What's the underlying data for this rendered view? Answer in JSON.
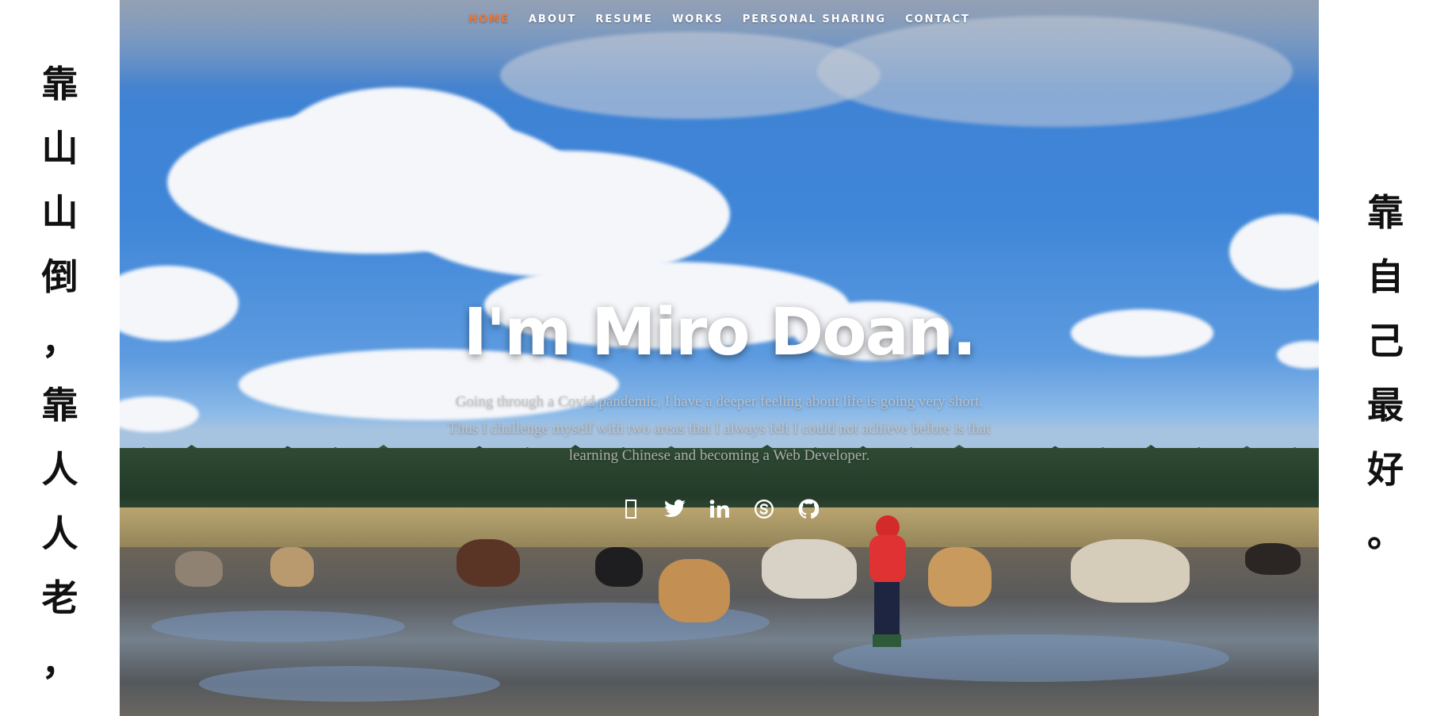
{
  "side_left": {
    "chars": [
      "靠",
      "山",
      "山",
      "倒",
      "，",
      "靠",
      "人",
      "人",
      "老",
      "，"
    ]
  },
  "side_right": {
    "chars": [
      "靠",
      "自",
      "己",
      "最",
      "好",
      "。"
    ]
  },
  "nav": {
    "items": [
      {
        "label": "HOME",
        "active": true
      },
      {
        "label": "ABOUT",
        "active": false
      },
      {
        "label": "RESUME",
        "active": false
      },
      {
        "label": "WORKS",
        "active": false
      },
      {
        "label": "PERSONAL SHARING",
        "active": false
      },
      {
        "label": "CONTACT",
        "active": false
      }
    ]
  },
  "banner": {
    "headline": "I'm Miro Doan.",
    "tagline": "Going through a Covid pandemic, I have a deeper feeling about life is going very short. Thus I challenge myself with two areas that I always felt I could not achieve before is that learning Chinese and becoming a Web Developer."
  },
  "social": {
    "icons": [
      "facebook-icon",
      "twitter-icon",
      "linkedin-icon",
      "skype-icon",
      "github-icon"
    ]
  },
  "colors": {
    "accent": "#f2762e",
    "text_dark": "#111111",
    "white": "#ffffff"
  }
}
